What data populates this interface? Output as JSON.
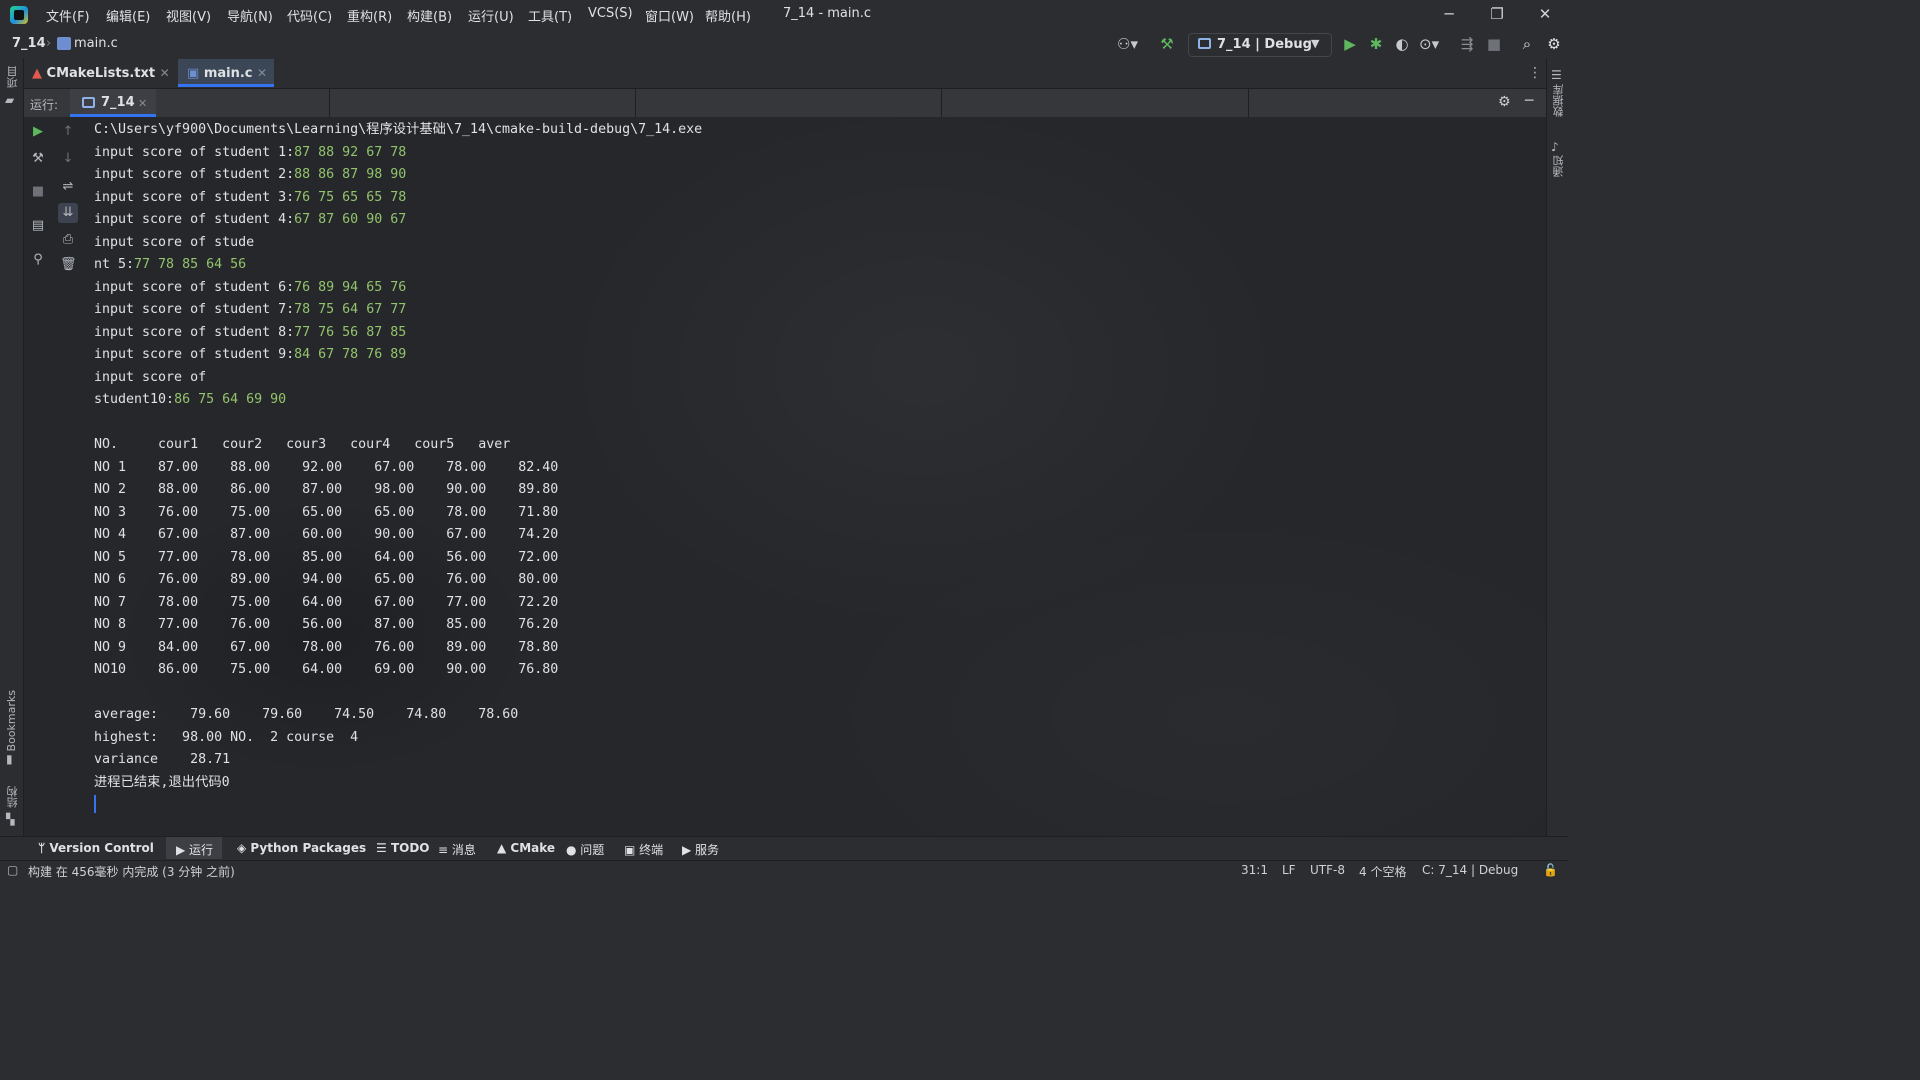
{
  "menu": [
    "文件(F)",
    "编辑(E)",
    "视图(V)",
    "导航(N)",
    "代码(C)",
    "重构(R)",
    "构建(B)",
    "运行(U)",
    "工具(T)",
    "VCS(S)",
    "窗口(W)",
    "帮助(H)"
  ],
  "window_title": "7_14 - main.c",
  "window_controls": {
    "minimize": "─",
    "restore": "❐",
    "close": "✕"
  },
  "breadcrumb": {
    "project": "7_14",
    "file": "main.c"
  },
  "run_config": {
    "label": "7_14 | Debug"
  },
  "toolbar_icons": [
    "user-icon",
    "hammer-icon",
    "run-icon",
    "debug-icon",
    "coverage-icon",
    "profile-icon",
    "attach-icon",
    "stop-icon",
    "search-icon",
    "settings-icon"
  ],
  "editor_tabs": [
    {
      "label": "CMakeLists.txt",
      "icon": "cmake-icon"
    },
    {
      "label": "main.c",
      "icon": "c-file-icon",
      "active": true
    }
  ],
  "run_panel": {
    "header_label": "运行:",
    "tab_label": "7_14"
  },
  "console": {
    "exe_path": "C:\\Users\\yf900\\Documents\\Learning\\程序设计基础\\7_14\\cmake-build-debug\\7_14.exe",
    "lines": [
      {
        "prompt": "input score of student 1:",
        "input": "87 88 92 67 78"
      },
      {
        "prompt": "input score of student 2:",
        "input": "88 86 87 98 90"
      },
      {
        "prompt": "input score of student 3:",
        "input": "76 75 65 65 78"
      },
      {
        "prompt": "input score of student 4:",
        "input": "67 87 60 90 67"
      },
      {
        "prompt": "input score of stude",
        "input": ""
      },
      {
        "prompt": "nt 5:",
        "input": "77 78 85 64 56"
      },
      {
        "prompt": "input score of student 6:",
        "input": "76 89 94 65 76"
      },
      {
        "prompt": "input score of student 7:",
        "input": "78 75 64 67 77"
      },
      {
        "prompt": "input score of student 8:",
        "input": "77 76 56 87 85"
      },
      {
        "prompt": "input score of student 9:",
        "input": "84 67 78 76 89"
      },
      {
        "prompt": "input score of ",
        "input": ""
      },
      {
        "prompt": "student10:",
        "input": "86 75 64 69 90"
      }
    ],
    "table_header": "NO.     cour1   cour2   cour3   cour4   cour5   aver",
    "table_rows": [
      "NO 1    87.00    88.00    92.00    67.00    78.00    82.40",
      "NO 2    88.00    86.00    87.00    98.00    90.00    89.80",
      "NO 3    76.00    75.00    65.00    65.00    78.00    71.80",
      "NO 4    67.00    87.00    60.00    90.00    67.00    74.20",
      "NO 5    77.00    78.00    85.00    64.00    56.00    72.00",
      "NO 6    76.00    89.00    94.00    65.00    76.00    80.00",
      "NO 7    78.00    75.00    64.00    67.00    77.00    72.20",
      "NO 8    77.00    76.00    56.00    87.00    85.00    76.20",
      "NO 9    84.00    67.00    78.00    76.00    89.00    78.80",
      "NO10    86.00    75.00    64.00    69.00    90.00    76.80"
    ],
    "average_line": "average:    79.60    79.60    74.50    74.80    78.60",
    "highest_line": "highest:   98.00 NO.  2 course  4",
    "variance_line": "variance    28.71",
    "exit_line": "进程已结束,退出代码0"
  },
  "left_strip": {
    "bookmarks": "Bookmarks",
    "structure": "结构",
    "project": "项目"
  },
  "right_strip": {
    "database": "数据库",
    "notifications": "通知"
  },
  "tool_windows": [
    {
      "label": "Version Control",
      "icon": "branch-icon"
    },
    {
      "label": "运行",
      "icon": "run-icon",
      "active": true
    },
    {
      "label": "Python Packages",
      "icon": "packages-icon"
    },
    {
      "label": "TODO",
      "icon": "list-icon"
    },
    {
      "label": "消息",
      "icon": "messages-icon"
    },
    {
      "label": "CMake",
      "icon": "cmake-icon"
    },
    {
      "label": "问题",
      "icon": "problems-icon"
    },
    {
      "label": "终端",
      "icon": "terminal-icon"
    },
    {
      "label": "服务",
      "icon": "services-icon"
    }
  ],
  "status": {
    "message": "构建 在 456毫秒 内完成 (3 分钟 之前)",
    "position": "31:1",
    "line_ending": "LF",
    "encoding": "UTF-8",
    "indent": "4 个空格",
    "context": "C: 7_14 | Debug"
  }
}
